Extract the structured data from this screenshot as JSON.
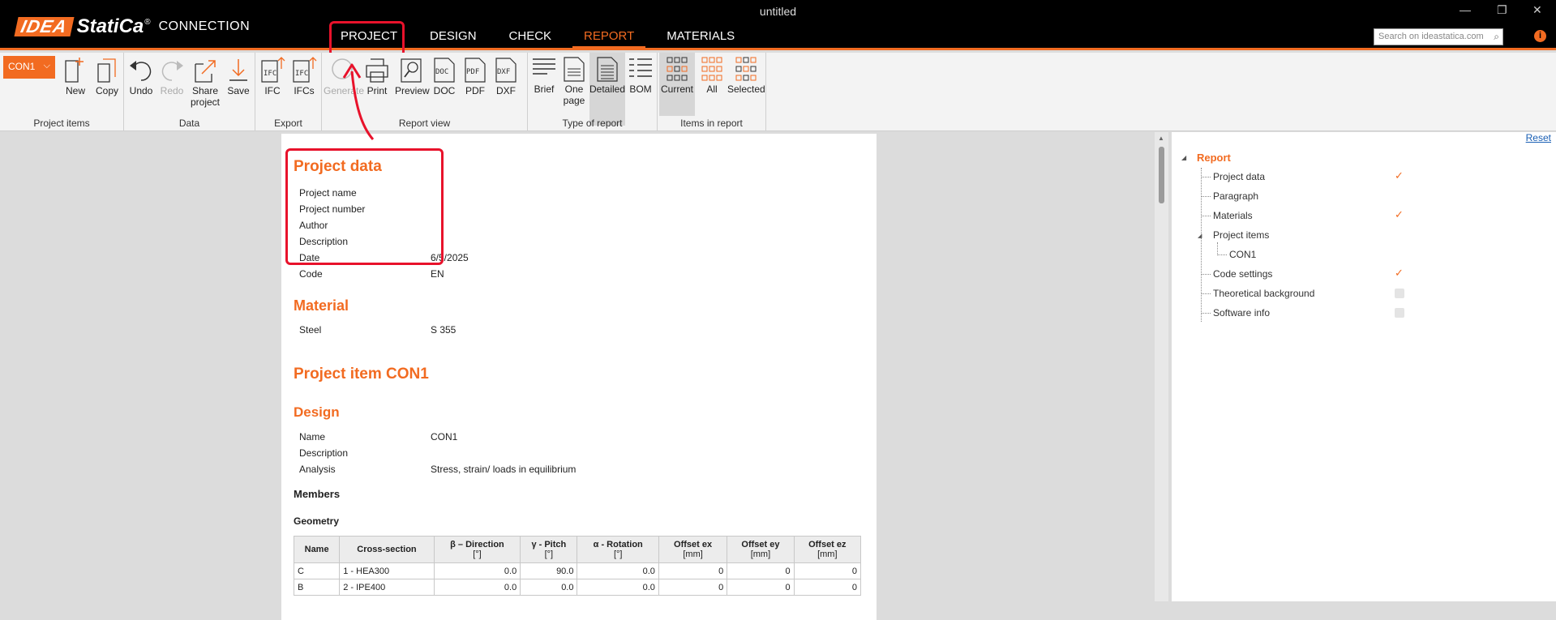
{
  "window": {
    "title": "untitled",
    "logo_idea": "IDEA",
    "logo_statica": "StatiCa",
    "logo_reg": "®",
    "product": "CONNECTION",
    "min_icon": "—",
    "restore_icon": "❐",
    "close_icon": "✕"
  },
  "menu": {
    "tabs": [
      "PROJECT",
      "DESIGN",
      "CHECK",
      "REPORT",
      "MATERIALS"
    ],
    "active": "REPORT"
  },
  "search": {
    "placeholder": "Search on ideastatica.com"
  },
  "ribbon": {
    "item_selector": "CON1",
    "groups": {
      "project_items": "Project items",
      "data": "Data",
      "export": "Export",
      "report_view": "Report view",
      "type_of_report": "Type of report",
      "items_in_report": "Items in report"
    },
    "buttons": {
      "new": "New",
      "copy": "Copy",
      "undo": "Undo",
      "redo": "Redo",
      "share": "Share project",
      "save": "Save",
      "ifc": "IFC",
      "ifcs": "IFCs",
      "generate": "Generate",
      "print": "Print",
      "preview": "Preview",
      "doc": "DOC",
      "pdf": "PDF",
      "dxf": "DXF",
      "brief": "Brief",
      "one_page": "One page",
      "detailed": "Detailed",
      "bom": "BOM",
      "current": "Current",
      "all": "All",
      "selected": "Selected"
    }
  },
  "report": {
    "project_data": {
      "heading": "Project data",
      "rows": [
        {
          "label": "Project name",
          "value": ""
        },
        {
          "label": "Project number",
          "value": ""
        },
        {
          "label": "Author",
          "value": ""
        },
        {
          "label": "Description",
          "value": ""
        },
        {
          "label": "Date",
          "value": "6/5/2025"
        },
        {
          "label": "Code",
          "value": "EN"
        }
      ]
    },
    "material": {
      "heading": "Material",
      "rows": [
        {
          "label": "Steel",
          "value": "S 355"
        }
      ]
    },
    "project_item_heading": "Project item CON1",
    "design": {
      "heading": "Design",
      "rows": [
        {
          "label": "Name",
          "value": "CON1"
        },
        {
          "label": "Description",
          "value": ""
        },
        {
          "label": "Analysis",
          "value": "Stress, strain/ loads in equilibrium"
        }
      ]
    },
    "members_heading": "Members",
    "geometry_heading": "Geometry",
    "geometry_table": {
      "headers": [
        {
          "l1": "Name",
          "l2": ""
        },
        {
          "l1": "Cross-section",
          "l2": ""
        },
        {
          "l1": "β – Direction",
          "l2": "[°]"
        },
        {
          "l1": "γ - Pitch",
          "l2": "[°]"
        },
        {
          "l1": "α - Rotation",
          "l2": "[°]"
        },
        {
          "l1": "Offset ex",
          "l2": "[mm]"
        },
        {
          "l1": "Offset ey",
          "l2": "[mm]"
        },
        {
          "l1": "Offset ez",
          "l2": "[mm]"
        }
      ],
      "rows": [
        [
          "C",
          "1 - HEA300",
          "0.0",
          "90.0",
          "0.0",
          "0",
          "0",
          "0"
        ],
        [
          "B",
          "2 - IPE400",
          "0.0",
          "0.0",
          "0.0",
          "0",
          "0",
          "0"
        ]
      ]
    }
  },
  "right_panel": {
    "reset": "Reset",
    "root": "Report",
    "items": [
      {
        "label": "Project data",
        "checked": true
      },
      {
        "label": "Paragraph",
        "checked": null
      },
      {
        "label": "Materials",
        "checked": true
      },
      {
        "label": "Project items",
        "checked": null
      },
      {
        "label": "CON1",
        "checked": null
      },
      {
        "label": "Code settings",
        "checked": true
      },
      {
        "label": "Theoretical background",
        "checked": false
      },
      {
        "label": "Software info",
        "checked": false
      }
    ],
    "check_glyph": "✓"
  },
  "colors": {
    "accent": "#f26b21",
    "highlight": "#e8122b"
  }
}
